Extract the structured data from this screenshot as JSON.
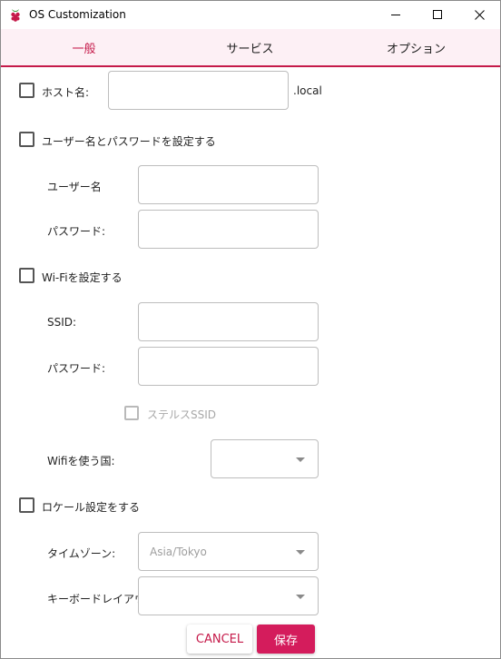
{
  "window": {
    "title": "OS Customization"
  },
  "tabs": [
    {
      "label": "一般",
      "active": true
    },
    {
      "label": "サービス",
      "active": false
    },
    {
      "label": "オプション",
      "active": false
    }
  ],
  "hostname": {
    "label": "ホスト名:",
    "value": "",
    "suffix": ".local"
  },
  "user": {
    "checkbox_label": "ユーザー名とパスワードを設定する",
    "username_label": "ユーザー名",
    "username_value": "",
    "password_label": "パスワード:",
    "password_value": ""
  },
  "wifi": {
    "checkbox_label": "Wi-Fiを設定する",
    "ssid_label": "SSID:",
    "ssid_value": "",
    "password_label": "パスワード:",
    "password_value": "",
    "hidden_ssid_label": "ステルスSSID",
    "country_label": "Wifiを使う国:",
    "country_value": ""
  },
  "locale": {
    "checkbox_label": "ロケール設定をする",
    "timezone_label": "タイムゾーン:",
    "timezone_value": "Asia/Tokyo",
    "keyboard_label": "キーボードレイアウト:",
    "keyboard_value": ""
  },
  "buttons": {
    "cancel": "CANCEL",
    "save": "保存"
  },
  "colors": {
    "accent": "#c51a4a",
    "save_button": "#d41c5c",
    "tab_background": "#fdf0f5"
  }
}
